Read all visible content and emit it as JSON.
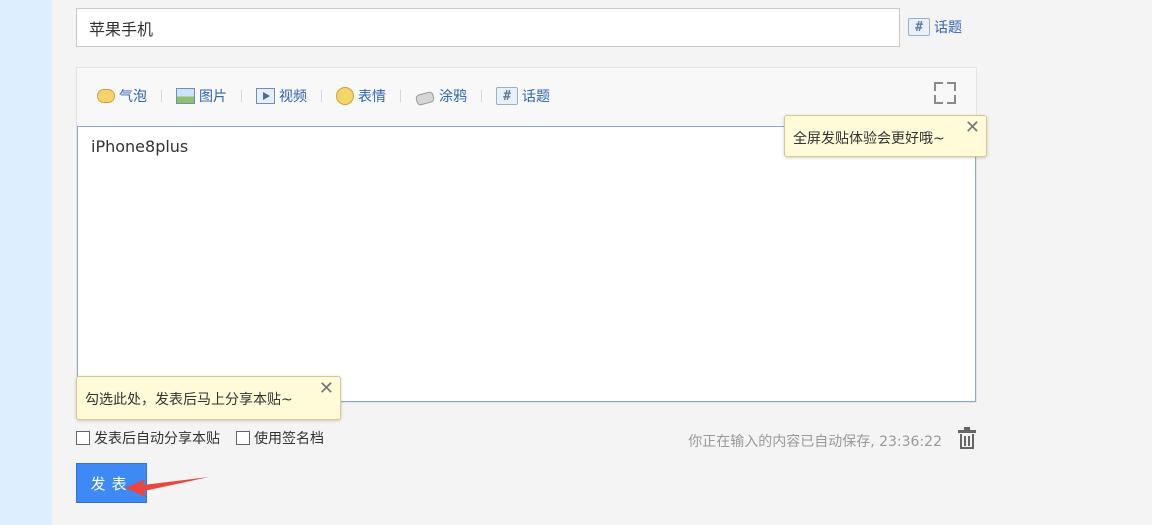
{
  "title_field": {
    "value": "苹果手机"
  },
  "topic_link_top": {
    "label": "话题",
    "icon": "hash-icon"
  },
  "toolbar": {
    "items": [
      {
        "label": "气泡",
        "icon": "bubble-icon"
      },
      {
        "label": "图片",
        "icon": "image-icon"
      },
      {
        "label": "视频",
        "icon": "video-icon"
      },
      {
        "label": "表情",
        "icon": "emoji-icon"
      },
      {
        "label": "涂鸦",
        "icon": "graffiti-icon"
      },
      {
        "label": "话题",
        "icon": "hash-icon"
      }
    ],
    "fullscreen_icon": "fullscreen-icon"
  },
  "editor": {
    "content": "iPhone8plus"
  },
  "tooltips": {
    "fullscreen_tip": "全屏发贴体验会更好哦~",
    "share_tip": "勾选此处，发表后马上分享本贴~",
    "close_glyph": "✕"
  },
  "options": {
    "auto_share": "发表后自动分享本贴",
    "use_signature": "使用签名档"
  },
  "autosave": {
    "text": "你正在输入的内容已自动保存, 23:36:22"
  },
  "submit": {
    "label": "发表"
  },
  "colors": {
    "accent": "#3d8af7",
    "link": "#2d64b3",
    "tip_bg": "#fffad8",
    "arrow": "#e8463f"
  }
}
